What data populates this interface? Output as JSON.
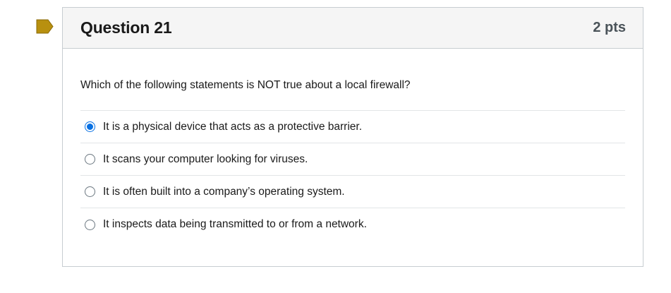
{
  "flag": {
    "icon": "bookmark-flag-icon",
    "color": "#b8900f"
  },
  "question": {
    "title": "Question 21",
    "points": "2 pts",
    "text": "Which of the following statements is NOT true about a local firewall?",
    "answers": [
      {
        "label": "It is a physical device that acts as a protective barrier.",
        "selected": true
      },
      {
        "label": "It scans your computer looking for viruses.",
        "selected": false
      },
      {
        "label": "It is often built into a company’s operating system.",
        "selected": false
      },
      {
        "label": "It inspects data being transmitted to or from a network.",
        "selected": false
      }
    ]
  },
  "colors": {
    "accent": "#0770e3",
    "header_bg": "#f5f5f5",
    "border": "#c7cdd1"
  }
}
